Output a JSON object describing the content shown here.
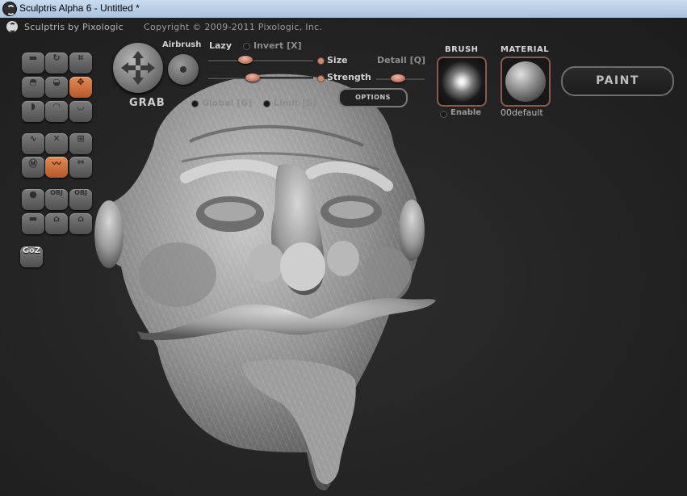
{
  "window": {
    "title": "Sculptris Alpha 6 - Untitled *"
  },
  "header": {
    "brand": "Sculptris by Pixologic",
    "copyright": "Copyright © 2009-2011 Pixologic, Inc."
  },
  "tools": {
    "goz_label": "GoZ",
    "obj_label": "OBJ"
  },
  "grab": {
    "label": "GRAB"
  },
  "airbrush": {
    "label": "Airbrush"
  },
  "controls": {
    "lazy": "Lazy",
    "invert": "Invert [X]",
    "size": "Size",
    "detail": "Detail [Q]",
    "strength": "Strength",
    "global": "Global [G]",
    "limit": "Limit [S]",
    "options": "OPTIONS"
  },
  "slider_levels": {
    "lazy": 0.35,
    "size": 0.35,
    "strength": 0.42,
    "detail": 0.45
  },
  "brush": {
    "title": "BRUSH",
    "enable": "Enable"
  },
  "material": {
    "title": "MATERIAL",
    "name": "00default"
  },
  "paint": {
    "label": "PAINT"
  },
  "colors": {
    "accent": "#d9824d",
    "knob": "#c98a72",
    "background": "#252525"
  }
}
